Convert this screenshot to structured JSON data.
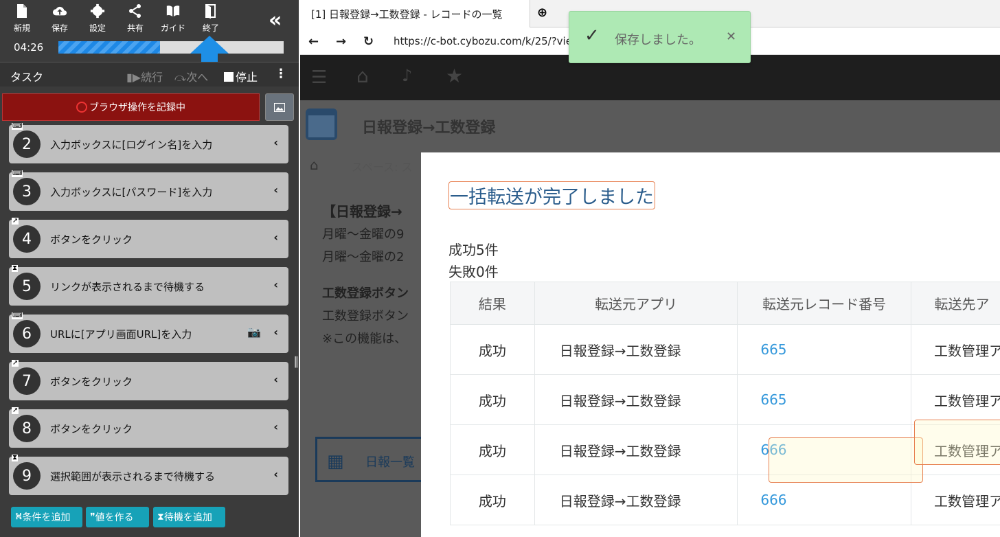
{
  "toolbar": {
    "new": "新規",
    "save": "保存",
    "settings": "設定",
    "share": "共有",
    "guide": "ガイド",
    "exit": "終了",
    "time": "04:26",
    "progress_percent": 45
  },
  "taskbar": {
    "label": "タスク",
    "continue": "続行",
    "next": "次へ",
    "stop": "停止"
  },
  "record": {
    "label": "ブラウザ操作を記録中"
  },
  "steps": [
    {
      "num": "2",
      "label": "入力ボックスに[ログイン名]を入力",
      "icon": "keyboard-icon"
    },
    {
      "num": "3",
      "label": "入力ボックスに[パスワード]を入力",
      "icon": "keyboard-icon"
    },
    {
      "num": "4",
      "label": "ボタンをクリック",
      "icon": "cursor-icon"
    },
    {
      "num": "5",
      "label": "リンクが表示されるまで待機する",
      "icon": "hourglass-icon"
    },
    {
      "num": "6",
      "label": "URLに[アプリ画面URL]を入力",
      "icon": "keyboard-icon"
    },
    {
      "num": "7",
      "label": "ボタンをクリック",
      "icon": "cursor-icon"
    },
    {
      "num": "8",
      "label": "ボタンをクリック",
      "icon": "cursor-icon"
    },
    {
      "num": "9",
      "label": "選択範囲が表示されるまで待機する",
      "icon": "hourglass-icon"
    }
  ],
  "actions": {
    "add_condition": "条件を追加",
    "make_value": "値を作る",
    "add_wait": "待機を追加"
  },
  "browser": {
    "tab_title": "[1] 日報登録→工数登録 - レコードの一覧",
    "url": "https://c-bot.cybozu.com/k/25/?view=552"
  },
  "app": {
    "title": "日報登録→工数登録",
    "breadcrumb": "スペース: ス",
    "bg_line1": "【日報登録→",
    "bg_line2": "月曜～金曜の9",
    "bg_line3": "月曜～金曜の2",
    "bg_line4": "工数登録ボタン",
    "bg_line5": "工数登録ボタン",
    "bg_line6": "※この機能は、",
    "list_button": "日報一覧"
  },
  "modal": {
    "title": "一括転送が完了しました",
    "success_count": "成功5件",
    "fail_count": "失敗0件",
    "headers": [
      "結果",
      "転送元アプリ",
      "転送元レコード番号",
      "転送先ア"
    ],
    "rows": [
      [
        "成功",
        "日報登録→工数登録",
        "665",
        "工数管理ア"
      ],
      [
        "成功",
        "日報登録→工数登録",
        "665",
        "工数管理ア"
      ],
      [
        "成功",
        "日報登録→工数登録",
        "666",
        "工数管理ア"
      ],
      [
        "成功",
        "日報登録→工数登録",
        "666",
        "工数管理ア"
      ]
    ]
  },
  "toast": {
    "message": "保存しました。"
  }
}
